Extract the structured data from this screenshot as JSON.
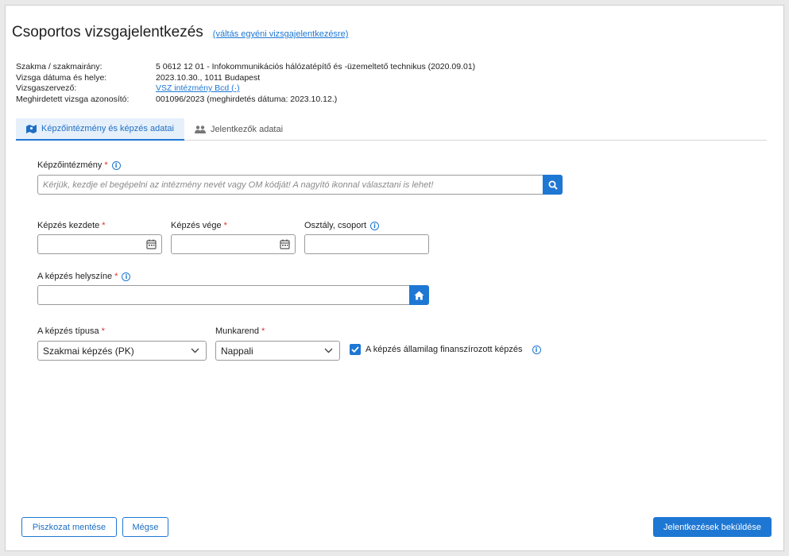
{
  "header": {
    "title": "Csoportos vizsgajelentkezés",
    "switch_link": "(váltás egyéni vizsgajelentkezésre)"
  },
  "info": {
    "rows": [
      {
        "label": "Szakma / szakmairány:",
        "value": "5 0612 12 01 - Infokommunikációs hálózatépítő és -üzemeltető technikus (2020.09.01)"
      },
      {
        "label": "Vizsga dátuma és helye:",
        "value": "2023.10.30., 1011 Budapest"
      },
      {
        "label": "Vizsgaszervező:",
        "value": "VSZ intézmény Bcd (·)"
      },
      {
        "label": "Meghirdetett vizsga azonosító:",
        "value": "001096/2023 (meghirdetés dátuma: 2023.10.12.)"
      }
    ]
  },
  "tabs": [
    {
      "label": "Képzőintézmény és képzés adatai",
      "active": true
    },
    {
      "label": "Jelentkezők adatai",
      "active": false
    }
  ],
  "form": {
    "institution": {
      "label": "Képzőintézmény",
      "required": "*",
      "placeholder": "Kérjük, kezdje el begépelni az intézmény nevét vagy OM kódját! A nagyító ikonnal választani is lehet!"
    },
    "start": {
      "label": "Képzés kezdete",
      "required": "*",
      "value": ""
    },
    "end": {
      "label": "Képzés vége",
      "required": "*",
      "value": ""
    },
    "class": {
      "label": "Osztály, csoport",
      "value": ""
    },
    "location": {
      "label": "A képzés helyszíne",
      "required": "*",
      "value": ""
    },
    "type": {
      "label": "A képzés típusa",
      "required": "*",
      "value": "Szakmai képzés (PK)"
    },
    "schedule": {
      "label": "Munkarend",
      "required": "*",
      "value": "Nappali"
    },
    "funded": {
      "label": "A képzés államilag finanszírozott képzés",
      "checked": true
    }
  },
  "footer": {
    "draft_button": "Piszkozat mentése",
    "cancel_button": "Mégse",
    "submit_button": "Jelentkezések beküldése"
  },
  "colors": {
    "accent": "#1e77d3",
    "required": "#d9342b"
  }
}
